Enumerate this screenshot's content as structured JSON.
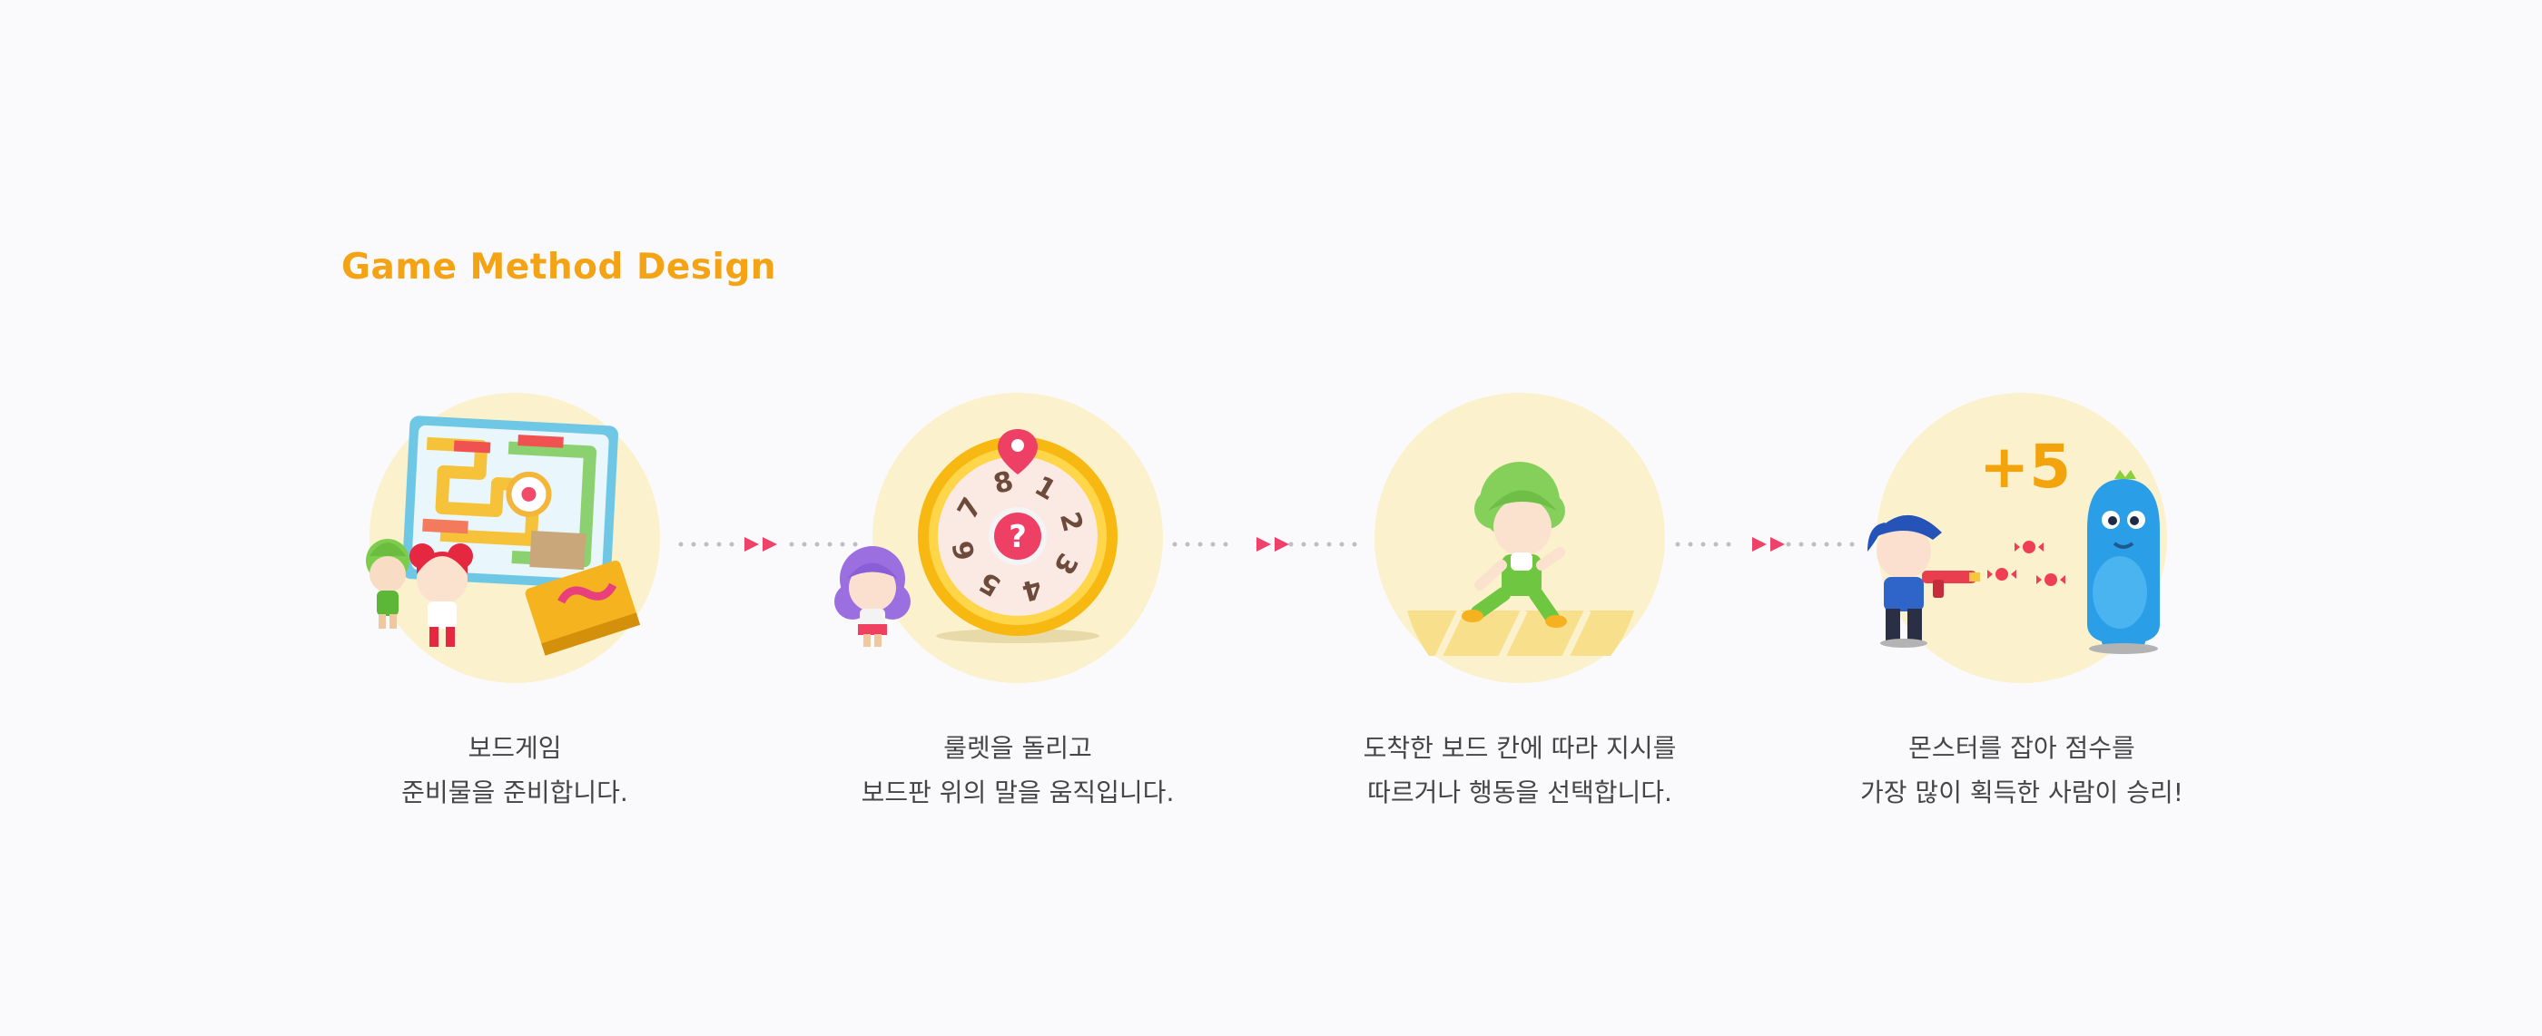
{
  "header": {
    "title": "Game Method Design"
  },
  "colors": {
    "accent": "#f4a315",
    "circle": "#fbf1cc",
    "arrow": "#f0416a",
    "dots": "#bdbdc2",
    "text": "#454545"
  },
  "steps": [
    {
      "icon": "board-game-set-illustration",
      "caption": [
        "보드게임",
        "준비물을 준비합니다."
      ]
    },
    {
      "icon": "roulette-wheel-illustration",
      "roulette_numbers": [
        "1",
        "2",
        "3",
        "4",
        "5",
        "6",
        "7",
        "8"
      ],
      "caption": [
        "룰렛을 돌리고",
        "보드판 위의 말을 움직입니다."
      ]
    },
    {
      "icon": "running-character-illustration",
      "caption": [
        "도착한 보드 칸에 따라 지시를",
        "따르거나 행동을 선택합니다."
      ]
    },
    {
      "icon": "monster-shooting-illustration",
      "score_badge": "+5",
      "caption": [
        "몬스터를 잡아 점수를",
        "가장 많이 획득한 사람이 승리!"
      ]
    }
  ]
}
